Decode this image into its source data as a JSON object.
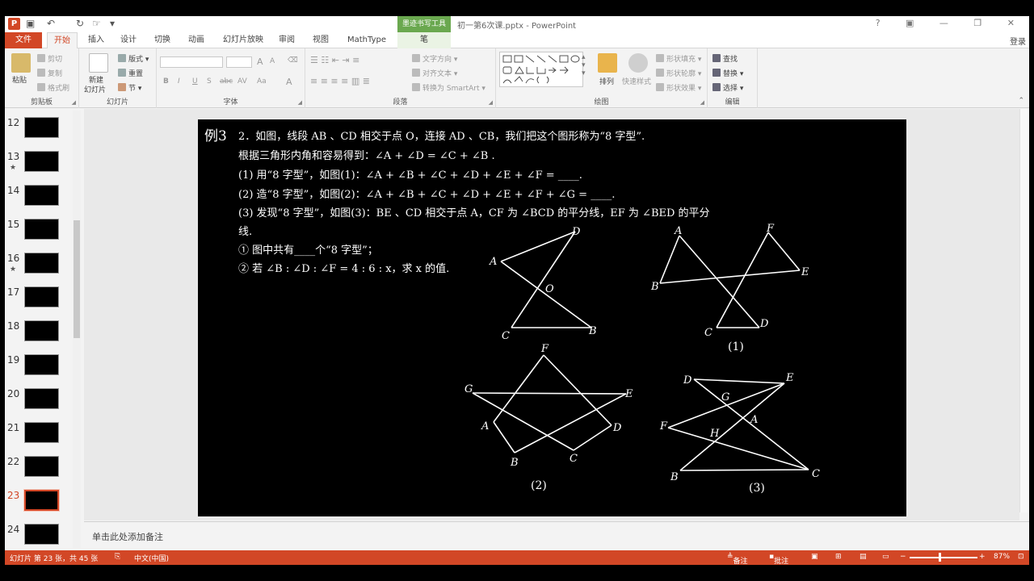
{
  "app": {
    "doc_title": "初一第6次课.pptx - PowerPoint",
    "context_tab_title": "墨迹书写工具",
    "login": "登录",
    "window_controls": "? ▣ — ❐ ✕"
  },
  "tabs": [
    "文件",
    "开始",
    "插入",
    "设计",
    "切换",
    "动画",
    "幻灯片放映",
    "审阅",
    "视图",
    "MathType"
  ],
  "context_tab_label": "笔",
  "ribbon": {
    "clipboard": {
      "label": "剪贴板",
      "paste": "粘贴",
      "cut": "剪切",
      "copy": "复制",
      "format_painter": "格式刷"
    },
    "slides": {
      "label": "幻灯片",
      "new_slide": "新建",
      "new_slide2": "幻灯片",
      "layout": "版式",
      "reset": "重置",
      "section": "节"
    },
    "font": {
      "label": "字体",
      "styles": [
        "B",
        "I",
        "U",
        "S",
        "abc",
        "AV",
        "Aa",
        "A"
      ],
      "grow": "A",
      "shrink": "A"
    },
    "paragraph": {
      "label": "段落",
      "text_direction": "文字方向",
      "align_text": "对齐文本",
      "smartart": "转换为 SmartArt"
    },
    "drawing": {
      "label": "绘图",
      "arrange": "排列",
      "quick_styles": "快速样式",
      "fill": "形状填充",
      "outline": "形状轮廓",
      "effects": "形状效果"
    },
    "editing": {
      "label": "编辑",
      "find": "查找",
      "replace": "替换",
      "select": "选择"
    }
  },
  "thumbnails": [
    {
      "num": "12",
      "star": ""
    },
    {
      "num": "13",
      "star": "★"
    },
    {
      "num": "14",
      "star": ""
    },
    {
      "num": "15",
      "star": ""
    },
    {
      "num": "16",
      "star": "★"
    },
    {
      "num": "17",
      "star": ""
    },
    {
      "num": "18",
      "star": ""
    },
    {
      "num": "19",
      "star": ""
    },
    {
      "num": "20",
      "star": ""
    },
    {
      "num": "21",
      "star": ""
    },
    {
      "num": "22",
      "star": ""
    },
    {
      "num": "23",
      "star": ""
    },
    {
      "num": "24",
      "star": ""
    }
  ],
  "selected_slide": "23",
  "slide": {
    "example": "例3",
    "lines": [
      "2．如图，线段 AB 、CD 相交于点 O，连接 AD 、CB，我们把这个图形称为“8 字型”.",
      "根据三角形内角和容易得到：∠A + ∠D = ∠C + ∠B .",
      "(1) 用“8 字型”，如图(1)：∠A + ∠B + ∠C + ∠D + ∠E + ∠F = ____.",
      "(2) 造“8 字型”，如图(2)：∠A + ∠B + ∠C + ∠D + ∠E + ∠F + ∠G = ____.",
      "(3) 发现“8 字型”，如图(3)：BE 、CD 相交于点 A，CF 为 ∠BCD 的平分线，EF 为 ∠BED 的平分",
      "线.",
      "① 图中共有____个“8 字型”；",
      "② 若 ∠B : ∠D : ∠F = 4 : 6 : x，求 x 的值."
    ],
    "figure_labels": {
      "fig0": [
        "A",
        "D",
        "O",
        "C",
        "B"
      ],
      "fig1": [
        "A",
        "F",
        "E",
        "B",
        "C",
        "D"
      ],
      "fig2": [
        "F",
        "G",
        "E",
        "A",
        "D",
        "B",
        "C"
      ],
      "fig3": [
        "D",
        "E",
        "G",
        "A",
        "F",
        "H",
        "B",
        "C"
      ]
    },
    "captions": [
      "(1)",
      "(2)",
      "(3)"
    ]
  },
  "notes_placeholder": "单击此处添加备注",
  "status": {
    "slide_info": "幻灯片 第 23 张，共 45 张",
    "language": "中文(中国)",
    "notes": "备注",
    "comments": "批注",
    "zoom": "87%",
    "minus": "−",
    "plus": "+"
  },
  "colors": {
    "accent": "#d24726",
    "context": "#6aa84f"
  }
}
